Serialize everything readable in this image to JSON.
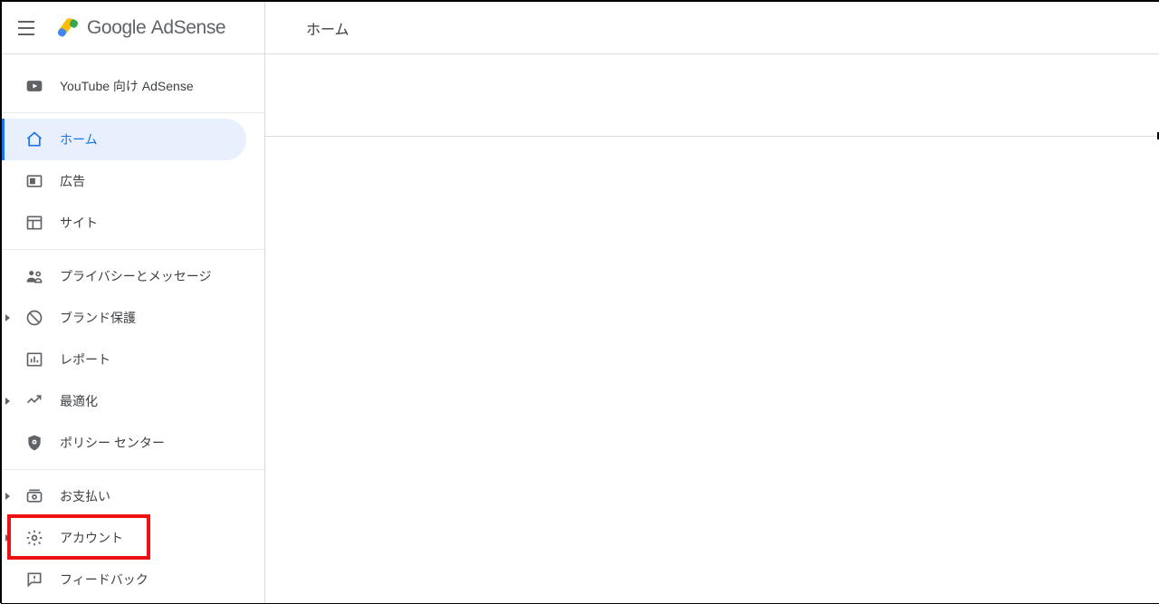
{
  "header": {
    "brand_primary": "Google",
    "brand_secondary": "AdSense",
    "page_title": "ホーム"
  },
  "sidebar": {
    "groups": [
      {
        "items": [
          {
            "key": "youtube",
            "label": "YouTube 向け AdSense",
            "icon": "youtube-icon",
            "expandable": false,
            "active": false
          }
        ]
      },
      {
        "items": [
          {
            "key": "home",
            "label": "ホーム",
            "icon": "home-icon",
            "expandable": false,
            "active": true
          },
          {
            "key": "ads",
            "label": "広告",
            "icon": "ads-icon",
            "expandable": false,
            "active": false
          },
          {
            "key": "sites",
            "label": "サイト",
            "icon": "sites-icon",
            "expandable": false,
            "active": false
          }
        ]
      },
      {
        "items": [
          {
            "key": "privacy",
            "label": "プライバシーとメッセージ",
            "icon": "privacy-icon",
            "expandable": false,
            "active": false
          },
          {
            "key": "brand",
            "label": "ブランド保護",
            "icon": "block-icon",
            "expandable": true,
            "active": false
          },
          {
            "key": "reports",
            "label": "レポート",
            "icon": "reports-icon",
            "expandable": false,
            "active": false
          },
          {
            "key": "optimize",
            "label": "最適化",
            "icon": "trend-icon",
            "expandable": true,
            "active": false
          },
          {
            "key": "policy",
            "label": "ポリシー センター",
            "icon": "shield-icon",
            "expandable": false,
            "active": false
          }
        ]
      },
      {
        "items": [
          {
            "key": "payments",
            "label": "お支払い",
            "icon": "payments-icon",
            "expandable": true,
            "active": false
          },
          {
            "key": "account",
            "label": "アカウント",
            "icon": "gear-icon",
            "expandable": true,
            "active": false,
            "annotated": true
          },
          {
            "key": "feedback",
            "label": "フィードバック",
            "icon": "feedback-icon",
            "expandable": false,
            "active": false
          }
        ]
      }
    ]
  },
  "annotation": {
    "highlighted_item": "account"
  }
}
